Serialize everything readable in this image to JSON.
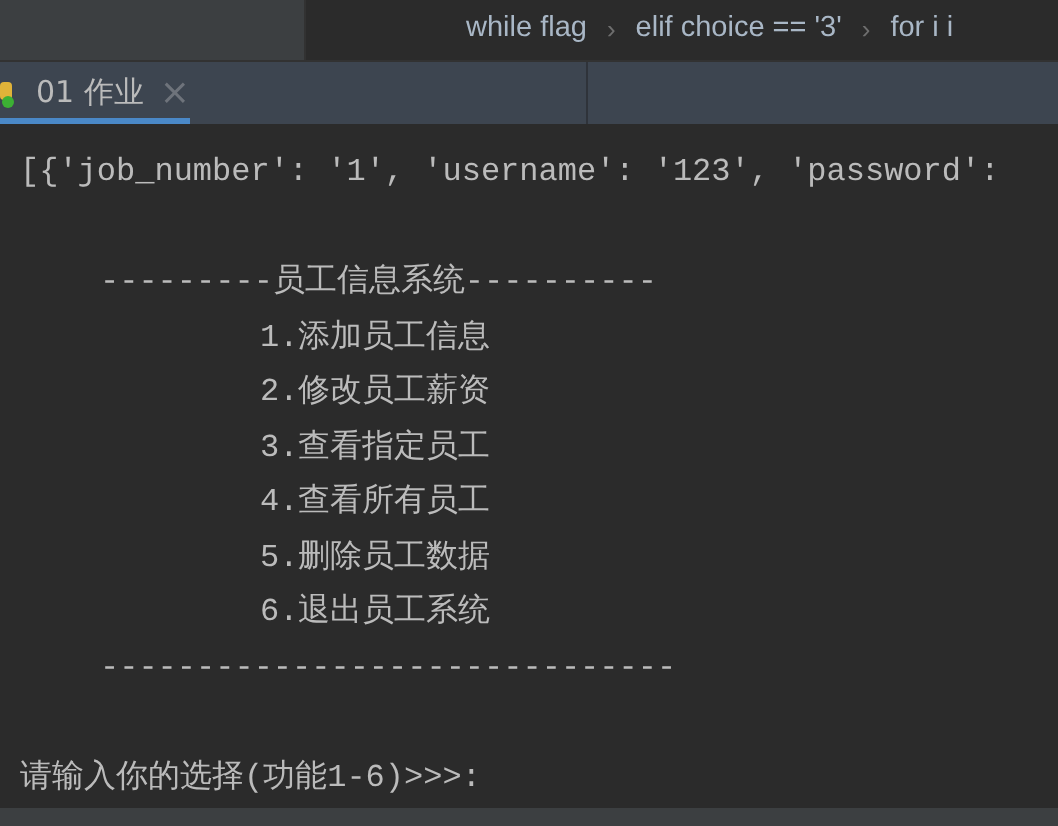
{
  "breadcrumbs": [
    {
      "label": "while flag"
    },
    {
      "label": "elif choice == '3'"
    },
    {
      "label": "for i i"
    }
  ],
  "separator": "›",
  "tabs": [
    {
      "label": "01 作业",
      "close": "×",
      "selected": true
    }
  ],
  "console": [
    {
      "kind": "output",
      "text": "[{'job_number': '1', 'username': '123', 'password':"
    },
    {
      "kind": "blank"
    },
    {
      "kind": "header",
      "text": "---------员工信息系统----------"
    },
    {
      "kind": "menu",
      "text": "1.添加员工信息"
    },
    {
      "kind": "menu",
      "text": "2.修改员工薪资"
    },
    {
      "kind": "menu",
      "text": "3.查看指定员工"
    },
    {
      "kind": "menu",
      "text": "4.查看所有员工"
    },
    {
      "kind": "menu",
      "text": "5.删除员工数据"
    },
    {
      "kind": "menu",
      "text": "6.退出员工系统"
    },
    {
      "kind": "header",
      "text": "------------------------------"
    },
    {
      "kind": "blank"
    },
    {
      "kind": "prompt",
      "text": "请输入你的选择(功能1-6)>>>:"
    }
  ]
}
